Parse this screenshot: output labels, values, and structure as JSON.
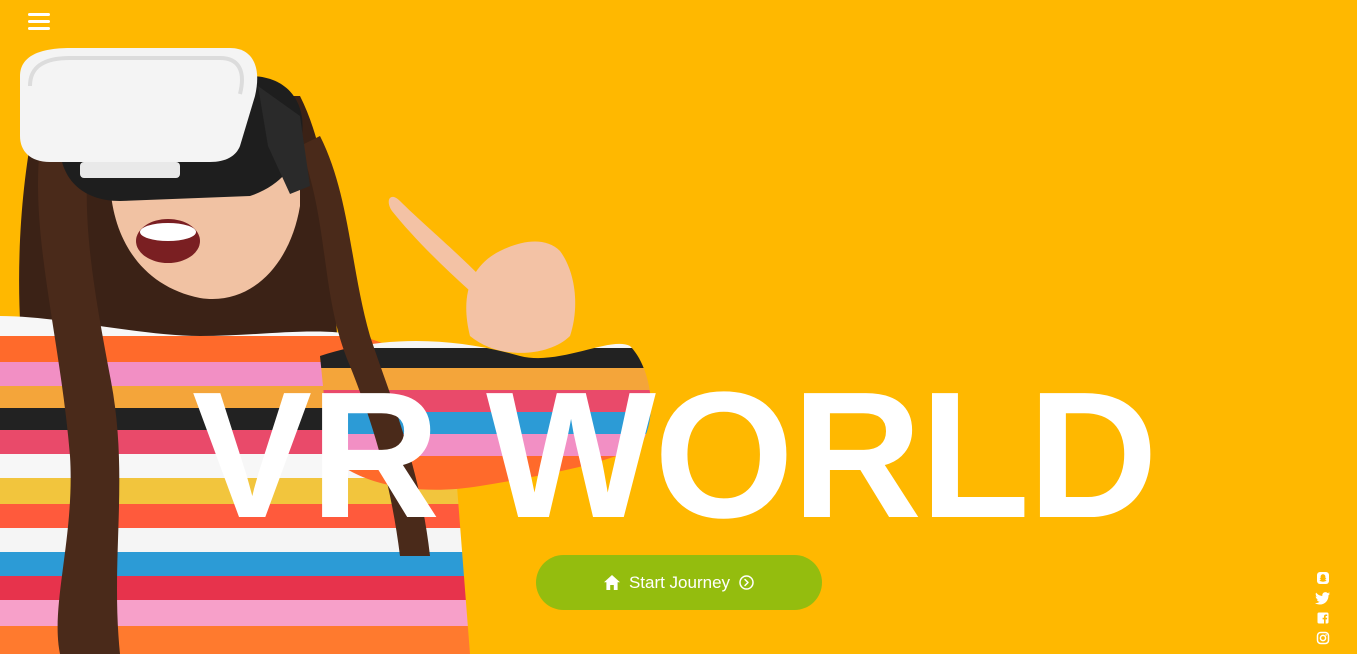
{
  "theme": {
    "background": "#FFB800",
    "accent_button": "#94BD0E",
    "text": "#FFFFFF"
  },
  "nav": {
    "menu_icon": "hamburger-menu-icon"
  },
  "hero": {
    "title": "VR WORLD",
    "image": "girl-wearing-vr-headset-pointing"
  },
  "cta": {
    "label": "Start Journey",
    "leading_icon": "home-icon",
    "trailing_icon": "chevron-circle-right-icon"
  },
  "social": {
    "icons": [
      "snapchat-icon",
      "twitter-icon",
      "facebook-icon",
      "instagram-icon"
    ]
  }
}
